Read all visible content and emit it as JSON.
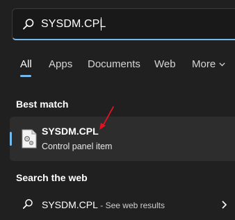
{
  "search": {
    "value": "SYSDM.CPL",
    "icon": "search-icon"
  },
  "tabs": [
    {
      "label": "All",
      "active": true
    },
    {
      "label": "Apps"
    },
    {
      "label": "Documents"
    },
    {
      "label": "Web"
    },
    {
      "label": "More"
    }
  ],
  "best_match": {
    "header": "Best match",
    "title": "SYSDM.CPL",
    "subtitle": "Control panel item",
    "icon": "control-panel-file-icon"
  },
  "web": {
    "header": "Search the web",
    "query": "SYSDM.CPL",
    "suffix": " - See web results",
    "icon": "search-icon"
  },
  "colors": {
    "background": "#202020",
    "accent": "#76b9ed",
    "selected": "#2d2d2d",
    "annotation_arrow": "#e81123"
  }
}
